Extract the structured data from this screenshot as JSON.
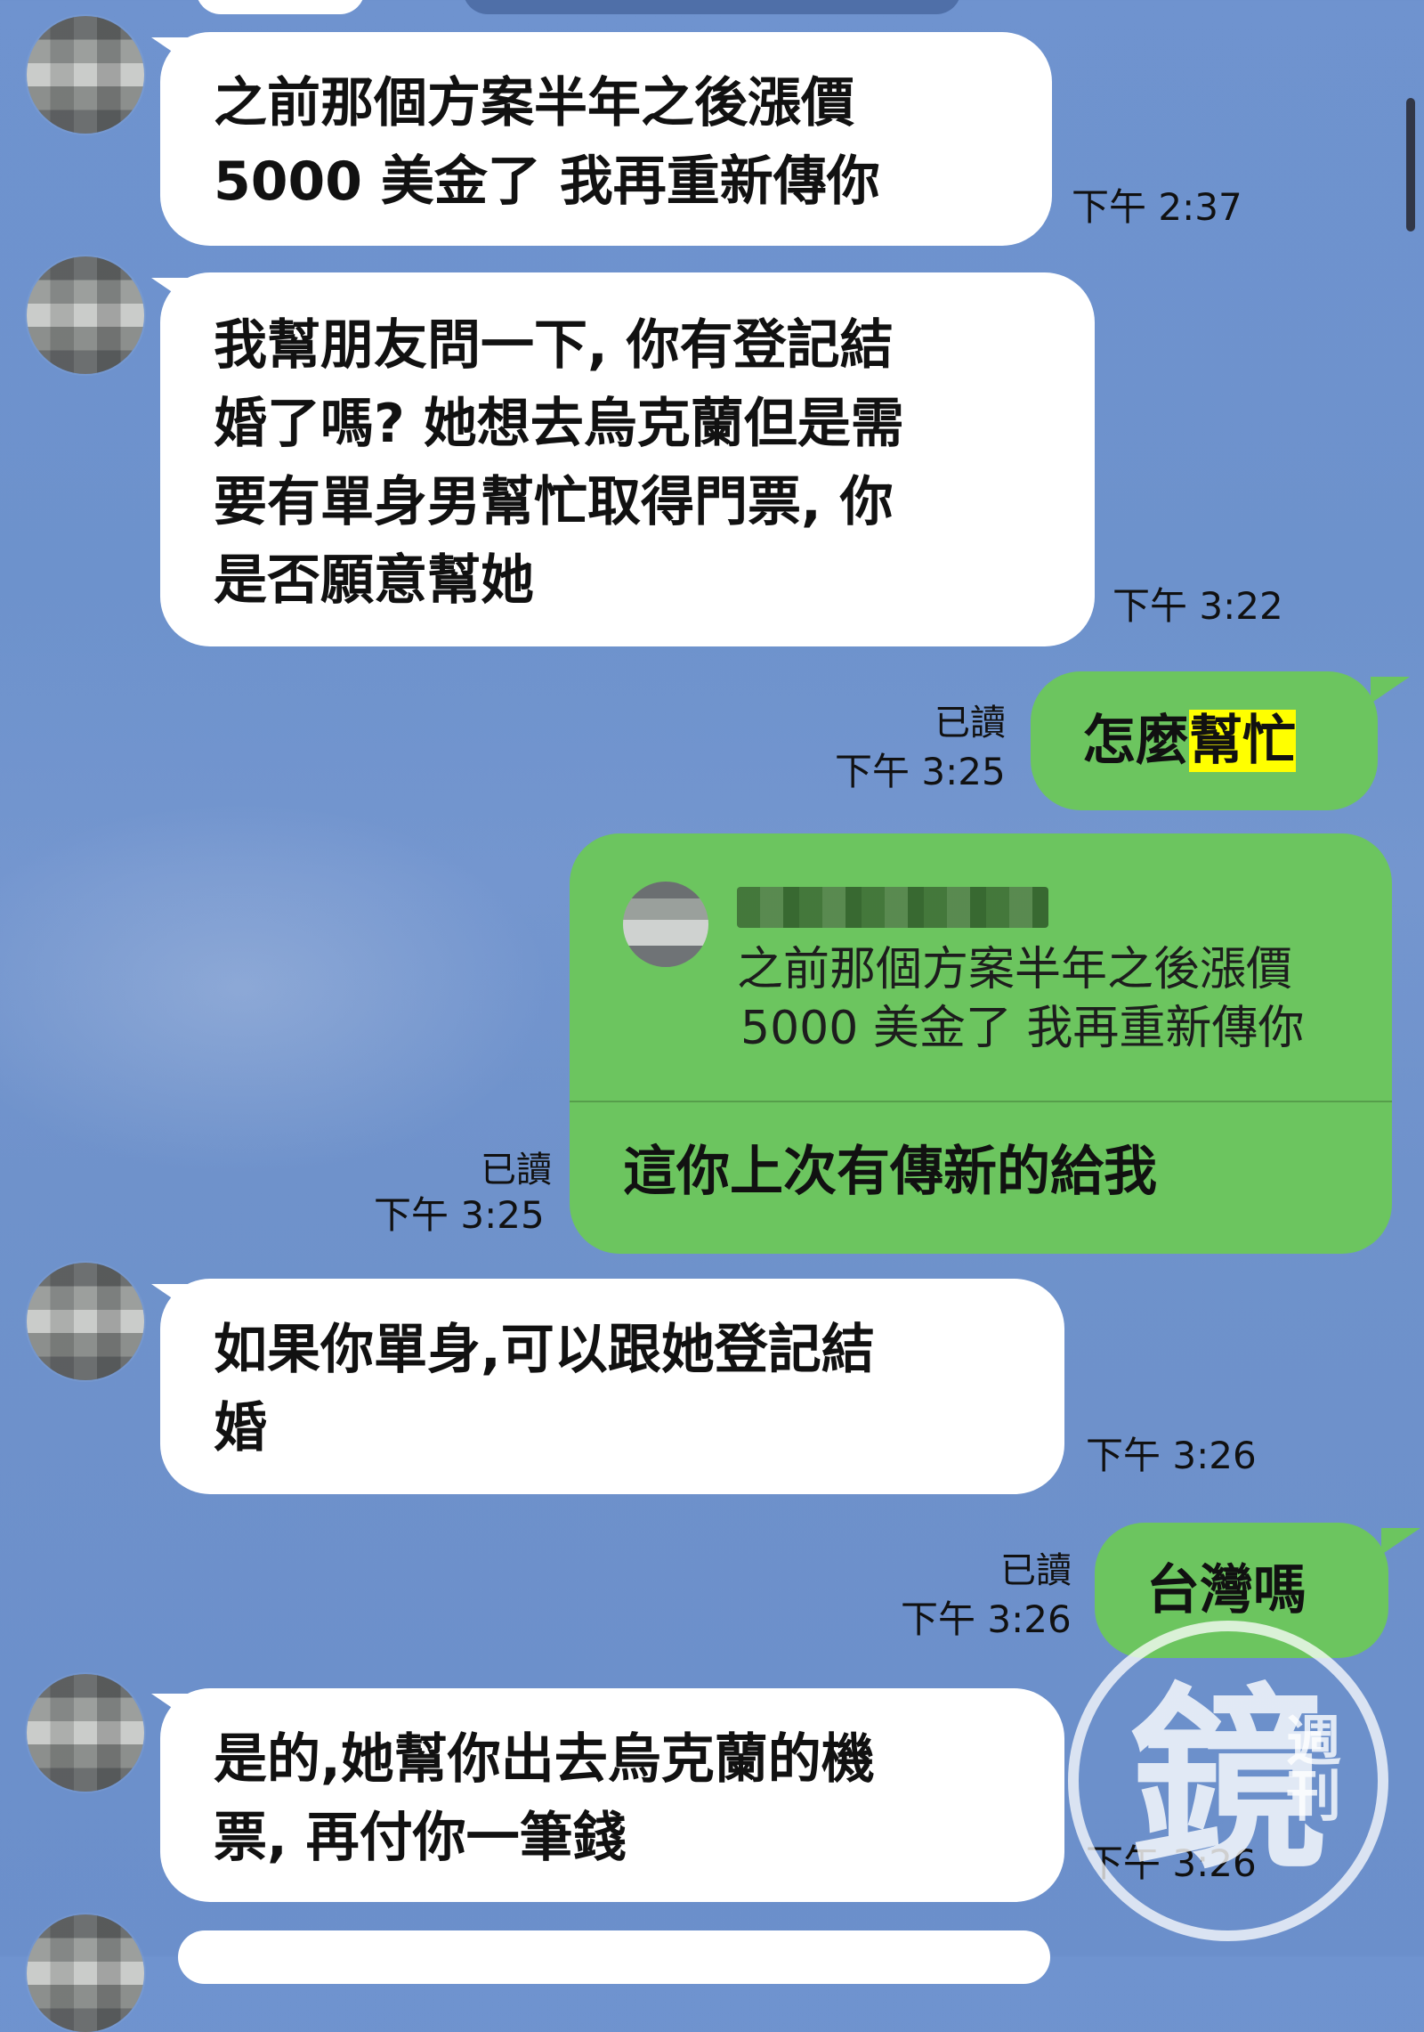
{
  "messages": [
    {
      "id": "m1",
      "side": "in",
      "lines": [
        "之前那個方案半年之後漲價",
        "5000 美金了 我再重新傳你"
      ],
      "time": "下午 2:37"
    },
    {
      "id": "m2",
      "side": "in",
      "lines": [
        "我幫朋友問一下, 你有登記結",
        "婚了嗎? 她想去烏克蘭但是需",
        "要有單身男幫忙取得門票, 你",
        "是否願意幫她"
      ],
      "time": "下午 3:22"
    },
    {
      "id": "m3",
      "side": "out",
      "text_prefix": "怎麼",
      "text_highlight": "幫忙",
      "read": "已讀",
      "time": "下午 3:25"
    },
    {
      "id": "m4",
      "side": "out",
      "quote_lines": [
        "之前那個方案半年之後漲價",
        "5000 美金了 我再重新傳你"
      ],
      "text": "這你上次有傳新的給我",
      "read": "已讀",
      "time": "下午 3:25"
    },
    {
      "id": "m5",
      "side": "in",
      "lines": [
        "如果你單身,可以跟她登記結",
        "婚"
      ],
      "time": "下午 3:26"
    },
    {
      "id": "m6",
      "side": "out",
      "text": "台灣嗎",
      "read": "已讀",
      "time": "下午 3:26"
    },
    {
      "id": "m7",
      "side": "in",
      "lines": [
        "是的,她幫你出去烏克蘭的機",
        "票, 再付你一筆錢"
      ],
      "time": "下午 3:26"
    }
  ],
  "watermark": {
    "main": "鏡",
    "side": "週刊"
  },
  "colors": {
    "incoming_bubble": "#ffffff",
    "outgoing_bubble": "#6cc55f",
    "highlight": "#ffff00",
    "background": "#6f93cf"
  }
}
